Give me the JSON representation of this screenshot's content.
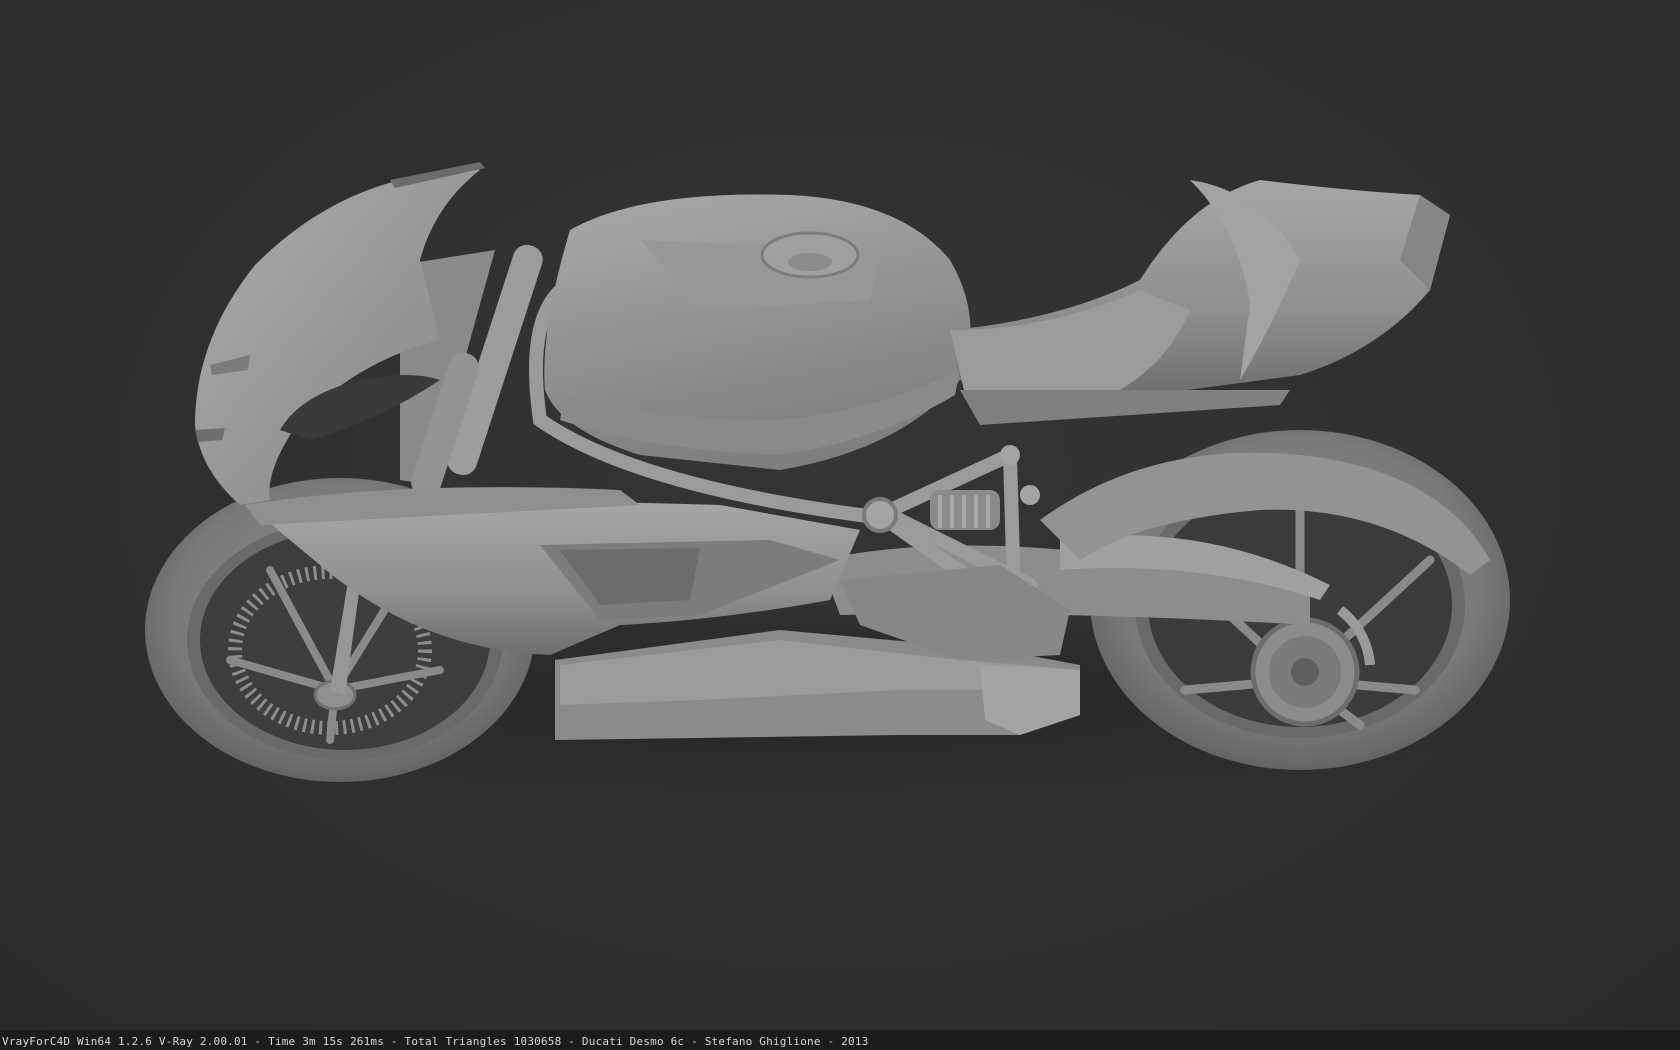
{
  "render": {
    "subject": "motorcycle",
    "background_color": "#2f2f2f",
    "clay_color": "#9a9a9a",
    "stamp_text": "VrayForC4D Win64 1.2.6 V-Ray 2.00.01 - Time 3m 15s 261ms - Total Triangles 1030658 - Ducati Desmo 6c - Stefano Ghiglione - 2013"
  }
}
